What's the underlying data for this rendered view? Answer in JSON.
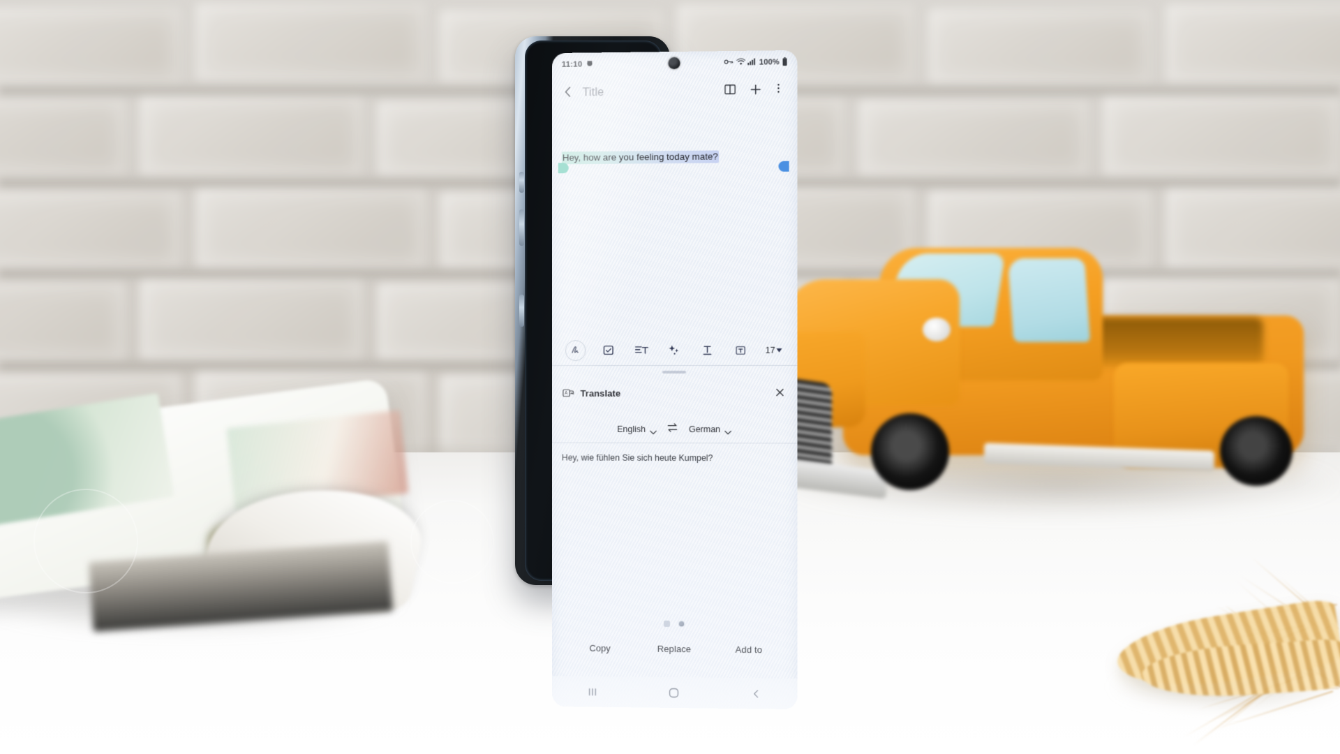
{
  "scene": {
    "description": "Smartphone standing on white table in front of blurred brick wall, open magazine at left, orange ceramic toy pickup truck at right, wheat stalks bottom right",
    "objects": [
      "brick-wall",
      "white-table",
      "open-magazine",
      "orange-toy-truck",
      "wheat-stalks"
    ]
  },
  "statusbar": {
    "time": "11:10",
    "left_icons": [
      "alarm-icon"
    ],
    "right_icons": [
      "vpn-key-icon",
      "wifi-icon",
      "signal-bars-icon"
    ],
    "battery_percent": "100%",
    "battery_icon": "battery-full-icon"
  },
  "appbar": {
    "back_icon": "chevron-left-icon",
    "title": "Title",
    "icons": [
      "book-view-icon",
      "plus-icon",
      "more-vertical-icon"
    ]
  },
  "note": {
    "text": "Hey, how are you feeling today mate?",
    "selection_start_handle": "selection-handle-left",
    "selection_end_handle": "selection-handle-right",
    "selection_color_start": "#b0e2d4",
    "selection_color_end": "#bcc9f0"
  },
  "toolbar": {
    "items": [
      {
        "name": "handwriting-pen-icon",
        "label": ""
      },
      {
        "name": "checkbox-list-icon",
        "label": ""
      },
      {
        "name": "text-align-icon",
        "label": ""
      },
      {
        "name": "ai-sparkle-icon",
        "label": ""
      },
      {
        "name": "text-underline-icon",
        "label": ""
      },
      {
        "name": "text-box-icon",
        "label": ""
      }
    ],
    "font_size": "17",
    "font_size_caret": "caret-down-icon"
  },
  "translate_panel": {
    "grabber": "drag-handle",
    "icon": "translate-icon",
    "title": "Translate",
    "close_icon": "close-icon",
    "source_language": "English",
    "source_caret": "chevron-down-icon",
    "swap_icon": "swap-horizontal-icon",
    "target_language": "German",
    "target_caret": "chevron-down-icon",
    "translated_text": "Hey, wie fühlen Sie sich heute Kumpel?",
    "page_dots": {
      "count": 2,
      "active_index": 1
    },
    "actions": [
      {
        "label": "Copy"
      },
      {
        "label": "Replace"
      },
      {
        "label": "Add to"
      }
    ]
  },
  "navbar": {
    "recents_icon": "recents-icon",
    "home_icon": "home-square-icon",
    "back_icon": "nav-back-icon"
  },
  "colors": {
    "screen_bg": "#eef2f8",
    "text_primary": "#23252b",
    "text_muted": "#9a9ea6",
    "truck_orange": "#f7a229",
    "truck_window_blue": "#bfe4ea",
    "frame_blue": "#b9c7d6"
  }
}
